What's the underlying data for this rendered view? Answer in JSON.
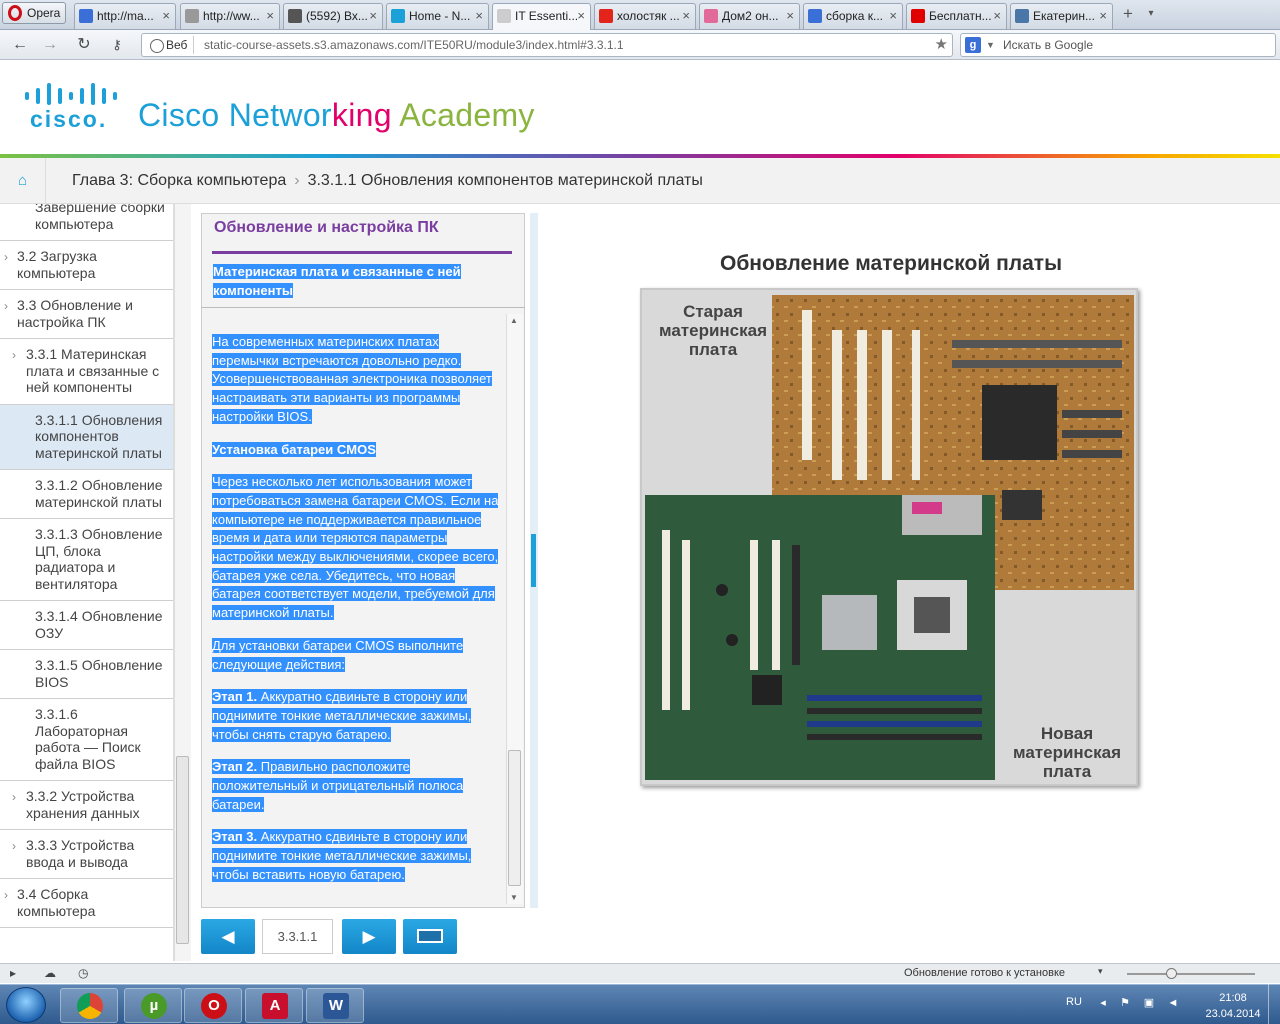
{
  "browser": {
    "menu_label": "Opera",
    "tabs": [
      {
        "label": "http://ma...",
        "icon_color": "#3b6fd8"
      },
      {
        "label": "http://ww...",
        "icon_color": "#999999"
      },
      {
        "label": "(5592) Вх...",
        "icon_color": "#555555"
      },
      {
        "label": "Home - N...",
        "icon_color": "#1ba0d7"
      },
      {
        "label": "IT Essenti...",
        "icon_color": "#cccccc"
      },
      {
        "label": "холостяк ...",
        "icon_color": "#e2241a"
      },
      {
        "label": "Дом2 он...",
        "icon_color": "#e26a9a"
      },
      {
        "label": "сборка к...",
        "icon_color": "#3b6fd8"
      },
      {
        "label": "Бесплатн...",
        "icon_color": "#e00000"
      },
      {
        "label": "Екатерин...",
        "icon_color": "#4a76a8"
      }
    ],
    "address": {
      "web_label": "Веб",
      "url": "static-course-assets.s3.amazonaws.com/ITE50RU/module3/index.html#3.3.1.1"
    },
    "search_placeholder": "Искать в Google"
  },
  "header": {
    "logo_word": "cisco.",
    "title_parts": [
      {
        "text": "Cisco ",
        "color": "#1ba0d7"
      },
      {
        "text": "Networ",
        "color": "#1ba0d7"
      },
      {
        "text": "king ",
        "color": "#e2006b"
      },
      {
        "text": "Academy",
        "color": "#8ab43d"
      }
    ]
  },
  "breadcrumb": {
    "chapter": "Глава 3: Сборка компьютера",
    "separator": "›",
    "current": "3.3.1.1 Обновления компонентов материнской платы"
  },
  "sidebar": {
    "items": [
      {
        "label": "Завершение сборки компьютера",
        "level": 3,
        "chevron": ""
      },
      {
        "label": "3.2 Загрузка компьютера",
        "level": 1,
        "chevron": "›"
      },
      {
        "label": "3.3 Обновление и настройка ПК",
        "level": 1,
        "chevron": "›"
      },
      {
        "label": "3.3.1 Материнская плата и связанные с ней компоненты",
        "level": 2,
        "chevron": "›"
      },
      {
        "label": "3.3.1.1 Обновления компонентов материнской платы",
        "level": 3,
        "chevron": "",
        "selected": true
      },
      {
        "label": "3.3.1.2 Обновление материнской платы",
        "level": 3,
        "chevron": ""
      },
      {
        "label": "3.3.1.3 Обновление ЦП, блока радиатора и вентилятора",
        "level": 3,
        "chevron": ""
      },
      {
        "label": "3.3.1.4 Обновление ОЗУ",
        "level": 3,
        "chevron": ""
      },
      {
        "label": "3.3.1.5 Обновление BIOS",
        "level": 3,
        "chevron": ""
      },
      {
        "label": "3.3.1.6 Лабораторная работа — Поиск файла BIOS",
        "level": 3,
        "chevron": ""
      },
      {
        "label": "3.3.2 Устройства хранения данных",
        "level": 2,
        "chevron": "›"
      },
      {
        "label": "3.3.3 Устройства ввода и вывода",
        "level": 2,
        "chevron": "›"
      },
      {
        "label": "3.4 Сборка компьютера",
        "level": 1,
        "chevron": "›"
      }
    ]
  },
  "panel": {
    "title": "Обновление и настройка ПК",
    "subtitle": "Материнская плата и связанные с ней компоненты",
    "paragraphs": [
      {
        "text": "На современных материнских платах перемычки встречаются довольно редко. Усовершенствованная электроника позволяет настраивать эти варианты из программы настройки BIOS."
      },
      {
        "bold": "Установка батареи CMOS"
      },
      {
        "text": "Через несколько лет использования может потребоваться замена батареи CMOS. Если на компьютере не поддерживается правильное время и дата или теряются параметры настройки между выключениями, скорее всего, батарея уже села. Убедитесь, что новая батарея соответствует модели, требуемой для материнской платы."
      },
      {
        "text": "Для установки батареи CMOS выполните следующие действия:"
      },
      {
        "bold": "Этап 1.",
        "text": " Аккуратно сдвиньте в сторону или поднимите тонкие металлические зажимы, чтобы снять старую батарею."
      },
      {
        "bold": "Этап 2.",
        "text": " Правильно расположите положительный и отрицательный полюса батареи."
      },
      {
        "bold": "Этап 3.",
        "text": " Аккуратно сдвиньте в сторону или поднимите тонкие металлические зажимы, чтобы вставить новую батарею."
      }
    ]
  },
  "navigation": {
    "prev_icon": "arrow-left-icon",
    "next_icon": "arrow-right-icon",
    "fullscreen_icon": "fullscreen-icon",
    "page_number": "3.3.1.1"
  },
  "figure": {
    "title": "Обновление материнской платы",
    "old_label": "Старая материнская плата",
    "new_label": "Новая материнская плата"
  },
  "statusbar": {
    "update_text": "Обновление готово к установке"
  },
  "taskbar": {
    "apps": [
      {
        "name": "chrome",
        "letter": "",
        "color": "#db4437"
      },
      {
        "name": "utorrent",
        "letter": "µ",
        "color": "#4a9a2a"
      },
      {
        "name": "opera",
        "letter": "O",
        "color": "#cc0f16"
      },
      {
        "name": "acrobat",
        "letter": "A",
        "color": "#c8102e"
      },
      {
        "name": "word",
        "letter": "W",
        "color": "#2b5797"
      }
    ],
    "lang": "RU",
    "time": "21:08",
    "date": "23.04.2014"
  }
}
